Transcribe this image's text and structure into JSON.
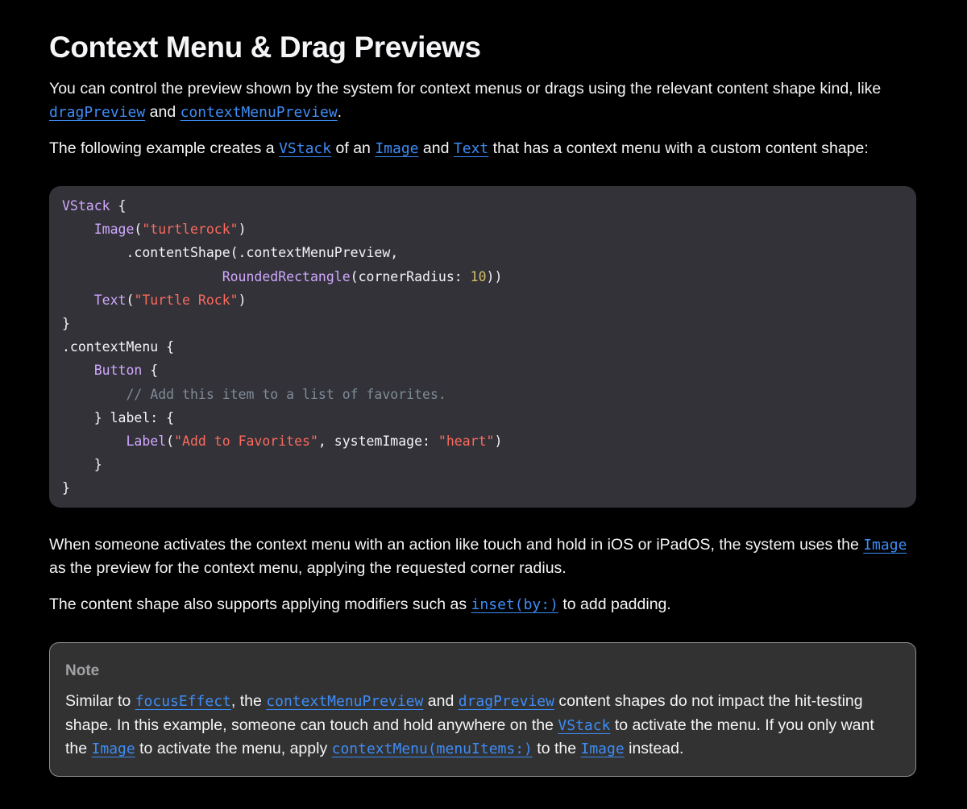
{
  "title": "Context Menu & Drag Previews",
  "para1": {
    "t1": "You can control the preview shown by the system for context menus or drags using the relevant content shape kind, like ",
    "link1": "dragPreview",
    "t2": " and ",
    "link2": "contextMenuPreview",
    "t3": "."
  },
  "para2": {
    "t1": "The following example creates a ",
    "link1": "VStack",
    "t2": " of an ",
    "link2": "Image",
    "t3": " and ",
    "link3": "Text",
    "t4": " that has a context menu with a custom content shape:"
  },
  "code": {
    "l1": {
      "a": "VStack",
      "b": " {"
    },
    "l2": {
      "indent": "    ",
      "a": "Image",
      "b": "(",
      "c": "\"turtlerock\"",
      "d": ")"
    },
    "l3": {
      "indent": "        ",
      "a": ".contentShape(.contextMenuPreview,"
    },
    "l4": {
      "indent": "                    ",
      "a": "RoundedRectangle",
      "b": "(cornerRadius: ",
      "c": "10",
      "d": "))"
    },
    "l5": {
      "indent": "    ",
      "a": "Text",
      "b": "(",
      "c": "\"Turtle Rock\"",
      "d": ")"
    },
    "l6": {
      "a": "}"
    },
    "l7": {
      "a": ".contextMenu {"
    },
    "l8": {
      "indent": "    ",
      "a": "Button",
      "b": " {"
    },
    "l9": {
      "indent": "        ",
      "a": "// Add this item to a list of favorites."
    },
    "l10": {
      "indent": "    ",
      "a": "} label: {"
    },
    "l11": {
      "indent": "        ",
      "a": "Label",
      "b": "(",
      "c": "\"Add to Favorites\"",
      "d": ", systemImage: ",
      "e": "\"heart\"",
      "f": ")"
    },
    "l12": {
      "indent": "    ",
      "a": "}"
    },
    "l13": {
      "a": "}"
    }
  },
  "para3": {
    "t1": "When someone activates the context menu with an action like touch and hold in iOS or iPadOS, the system uses the ",
    "link1": "Image",
    "t2": " as the preview for the context menu, applying the requested corner radius."
  },
  "para4": {
    "t1": "The content shape also supports applying modifiers such as ",
    "link1": "inset(by:)",
    "t2": " to add padding."
  },
  "note": {
    "title": "Note",
    "t1": "Similar to ",
    "link1": "focusEffect",
    "t2": ", the ",
    "link2": "contextMenuPreview",
    "t3": " and ",
    "link3": "dragPreview",
    "t4": " content shapes do not impact the hit-testing shape. In this example, someone can touch and hold anywhere on the ",
    "link4": "VStack",
    "t5": " to activate the menu. If you only want the ",
    "link5": "Image",
    "t6": " to activate the menu, apply ",
    "link6": "contextMenu(menuItems:)",
    "t7": " to the ",
    "link7": "Image",
    "t8": " instead."
  },
  "colors": {
    "background": "#000000",
    "text": "#f5f5f7",
    "link": "#3e8cf6",
    "code_background": "#323238",
    "code_type": "#d0a8ff",
    "code_string": "#fc6a5d",
    "code_number": "#d0bf69",
    "code_comment": "#7f8c98",
    "note_background": "#323232",
    "note_border": "#8e8e93",
    "note_title": "#a1a1a6"
  }
}
